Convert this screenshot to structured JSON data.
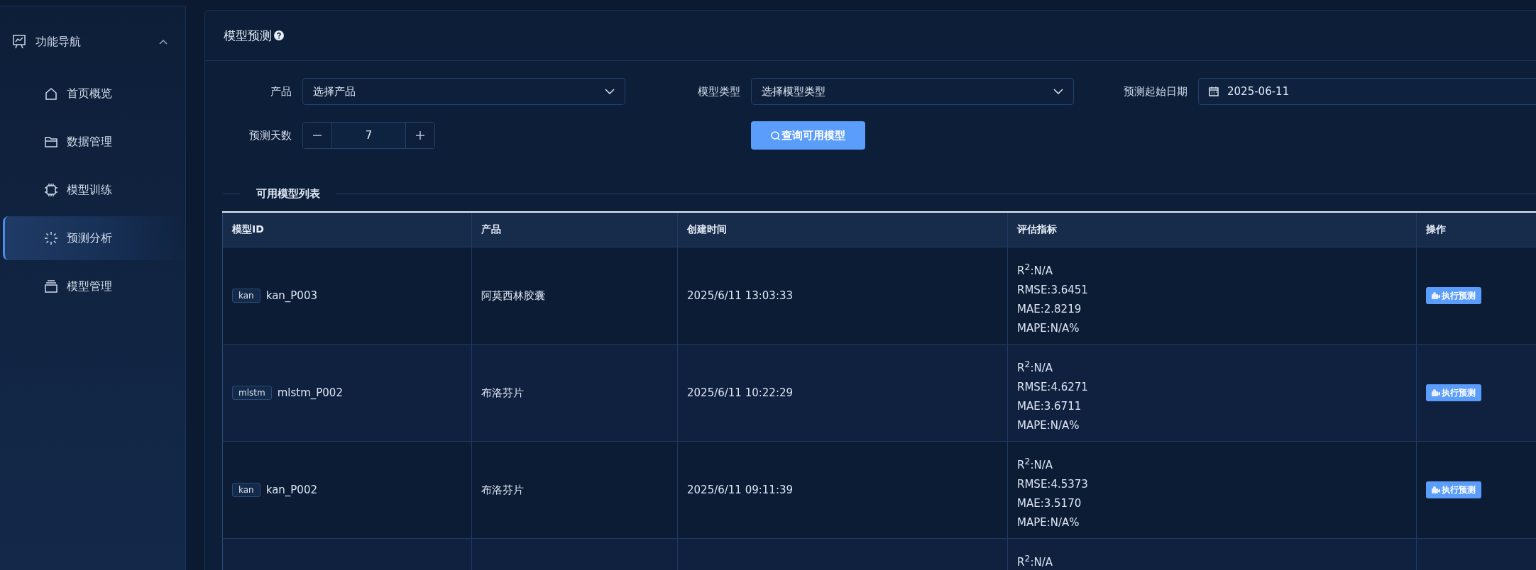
{
  "sidebar": {
    "title": "功能导航",
    "expanded": true,
    "items": [
      {
        "label": "首页概览",
        "selected": false
      },
      {
        "label": "数据管理",
        "selected": false
      },
      {
        "label": "模型训练",
        "selected": false
      },
      {
        "label": "预测分析",
        "selected": true
      },
      {
        "label": "模型管理",
        "selected": false
      }
    ]
  },
  "panel": {
    "title": "模型预测",
    "form": {
      "product": {
        "label": "产品",
        "placeholder": "选择产品"
      },
      "model_type": {
        "label": "模型类型",
        "placeholder": "选择模型类型"
      },
      "start_date": {
        "label": "预测起始日期",
        "value": "2025-06-11"
      },
      "days": {
        "label": "预测天数",
        "value": "7"
      },
      "query_button": "查询可用模型"
    },
    "section_title": "可用模型列表",
    "table": {
      "columns": [
        "模型ID",
        "产品",
        "创建时间",
        "评估指标",
        "操作"
      ],
      "rows": [
        {
          "tag": "kan",
          "id": "kan_P003",
          "product": "阿莫西林胶囊",
          "created": "2025/6/11 13:03:33",
          "metrics": [
            "R$^{2}$:N/A",
            "RMSE:3.6451",
            "MAE:2.8219",
            "MAPE:N/A%"
          ],
          "action": "执行预测"
        },
        {
          "tag": "mlstm",
          "id": "mlstm_P002",
          "product": "布洛芬片",
          "created": "2025/6/11 10:22:29",
          "metrics": [
            "R$^{2}$:N/A",
            "RMSE:4.6271",
            "MAE:3.6711",
            "MAPE:N/A%"
          ],
          "action": "执行预测"
        },
        {
          "tag": "kan",
          "id": "kan_P002",
          "product": "布洛芬片",
          "created": "2025/6/11 09:11:39",
          "metrics": [
            "R$^{2}$:N/A",
            "RMSE:4.5373",
            "MAE:3.5170",
            "MAPE:N/A%"
          ],
          "action": "执行预测"
        },
        {
          "metrics": [
            "R$^{2}$:N/A"
          ]
        }
      ]
    }
  }
}
